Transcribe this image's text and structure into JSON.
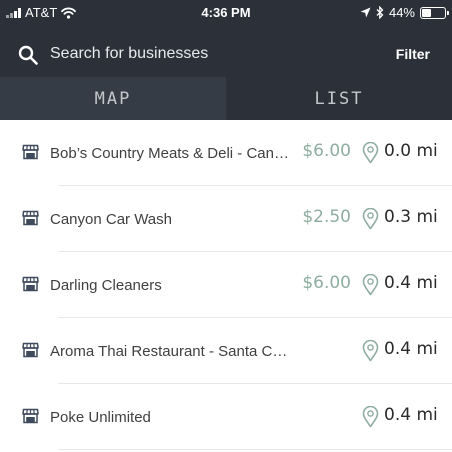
{
  "status_bar": {
    "carrier": "AT&T",
    "time": "4:36 PM",
    "battery_text": "44%",
    "battery_level": 0.44,
    "icons": [
      "signal-icon",
      "wifi-icon",
      "location-arrow-icon",
      "bluetooth-icon",
      "battery-icon"
    ]
  },
  "header": {
    "search_placeholder": "Search for businesses",
    "filter_label": "Filter"
  },
  "tabs": [
    {
      "label": "MAP"
    },
    {
      "label": "LIST"
    }
  ],
  "businesses": [
    {
      "name": "Bob’s Country Meats & Deli - Can…",
      "price": "$6.00",
      "distance": "0.0 mi"
    },
    {
      "name": "Canyon Car Wash",
      "price": "$2.50",
      "distance": "0.3 mi"
    },
    {
      "name": "Darling Cleaners",
      "price": "$6.00",
      "distance": "0.4 mi"
    },
    {
      "name": "Aroma Thai Restaurant - Santa C…",
      "price": "",
      "distance": "0.4 mi"
    },
    {
      "name": "Poke Unlimited",
      "price": "",
      "distance": "0.4 mi"
    }
  ],
  "colors": {
    "header_bg": "#2c3139",
    "tab_map_bg": "#363c45",
    "price": "#8eada0",
    "icon_accent": "#8eada0",
    "store_icon": "#3f4a5c"
  }
}
